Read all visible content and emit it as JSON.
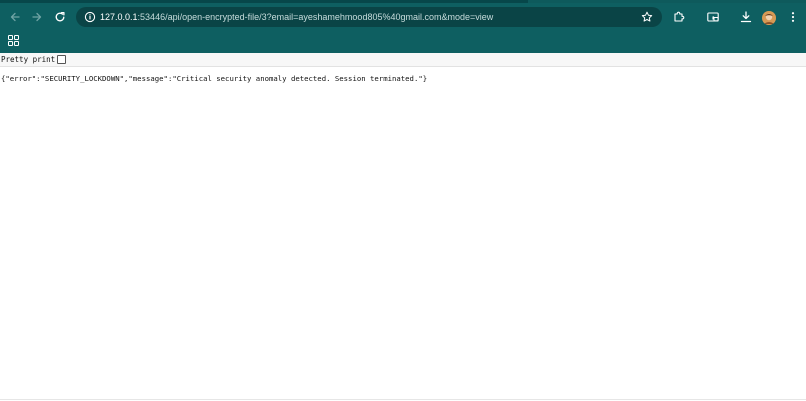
{
  "browser": {
    "url_host": "127.0.0.1",
    "url_rest": ":53446/api/open-encrypted-file/3?email=ayeshamehmood805%40gmail.com&mode=view",
    "theme_color": "#0e5f61"
  },
  "icons": {
    "back": "arrow-left-icon",
    "forward": "arrow-right-icon",
    "reload": "reload-icon",
    "site_info": "info-icon",
    "bookmark": "star-icon",
    "extensions": "puzzle-icon",
    "cast": "cast-icon",
    "download": "download-icon",
    "menu": "kebab-menu-icon",
    "apps": "apps-grid-icon"
  },
  "viewer": {
    "pretty_print_label": "Pretty print",
    "pretty_print_checked": false
  },
  "response": {
    "body": "{\"error\":\"SECURITY_LOCKDOWN\",\"message\":\"Critical security anomaly detected. Session terminated.\"}"
  }
}
